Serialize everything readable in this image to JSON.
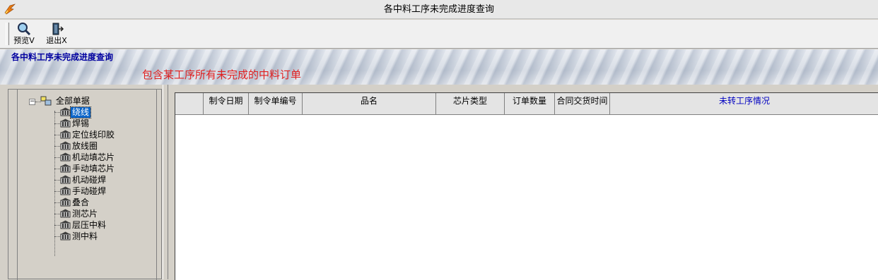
{
  "window": {
    "title": "各中料工序未完成进度查询"
  },
  "toolbar": {
    "preview_label": "预览V",
    "exit_label": "退出X"
  },
  "banner": {
    "title": "各中料工序未完成进度查询",
    "subtitle": "包含某工序所有未完成的中料订单"
  },
  "tree": {
    "root": "全部单据",
    "items": [
      "绕线",
      "焊锡",
      "定位线印胶",
      "放线圈",
      "机动填芯片",
      "手动填芯片",
      "机动碰焊",
      "手动碰焊",
      "叠合",
      "测芯片",
      "层压中料",
      "测中料"
    ],
    "selected_index": 0
  },
  "grid": {
    "columns": [
      "",
      "制令日期",
      "制令单编号",
      "品名",
      "芯片类型",
      "订单数量",
      "合同交货时间",
      "未转工序情况"
    ],
    "rows": []
  },
  "colors": {
    "banner_title": "#0000a0",
    "banner_subtitle": "#e02020",
    "selection": "#0a64c8"
  }
}
